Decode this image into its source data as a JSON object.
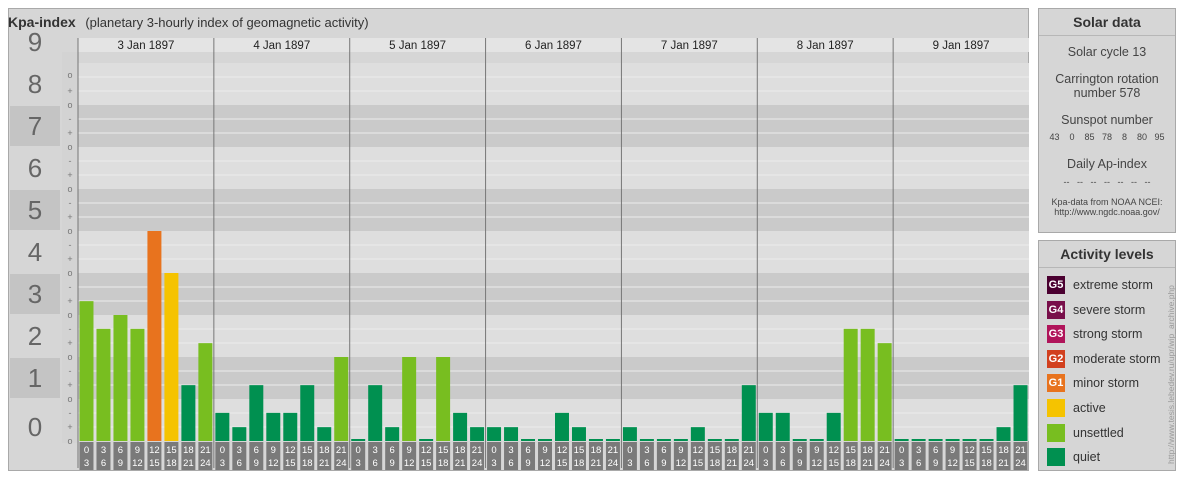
{
  "header": {
    "title": "Kpa-index",
    "subtitle": "(planetary 3-hourly index of geomagnetic activity)"
  },
  "chart_data": {
    "type": "bar",
    "title": "Kpa-index",
    "subtitle": "(planetary 3-hourly index of geomagnetic activity)",
    "ylim": [
      0,
      9
    ],
    "y_ticks": [
      "0",
      "1",
      "2",
      "3",
      "4",
      "5",
      "6",
      "7",
      "8",
      "9"
    ],
    "y_minor_marks": [
      "-",
      "o",
      "+"
    ],
    "days": [
      "3 Jan 1897",
      "4 Jan 1897",
      "5 Jan 1897",
      "6 Jan 1897",
      "7 Jan 1897",
      "8 Jan 1897",
      "9 Jan 1897"
    ],
    "intervals": [
      [
        "0",
        "3"
      ],
      [
        "3",
        "6"
      ],
      [
        "6",
        "9"
      ],
      [
        "9",
        "12"
      ],
      [
        "12",
        "15"
      ],
      [
        "15",
        "18"
      ],
      [
        "18",
        "21"
      ],
      [
        "21",
        "24"
      ]
    ],
    "values": [
      [
        3.33,
        2.67,
        3.0,
        2.67,
        5.0,
        4.0,
        1.33,
        2.33
      ],
      [
        0.67,
        0.33,
        1.33,
        0.67,
        0.67,
        1.33,
        0.33,
        2.0
      ],
      [
        0.0,
        1.33,
        0.33,
        2.0,
        0.0,
        2.0,
        0.67,
        0.33
      ],
      [
        0.33,
        0.33,
        0.0,
        0.0,
        0.67,
        0.33,
        0.0,
        0.0
      ],
      [
        0.33,
        0.0,
        0.0,
        0.0,
        0.33,
        0.0,
        0.0,
        1.33
      ],
      [
        0.67,
        0.67,
        0.0,
        0.0,
        0.67,
        2.67,
        2.67,
        2.33
      ],
      [
        0.0,
        0.0,
        0.0,
        0.0,
        0.0,
        0.0,
        0.33,
        1.33
      ]
    ],
    "levels": [
      {
        "label": "extreme storm",
        "code": "G5",
        "color": "#4a0030"
      },
      {
        "label": "severe storm",
        "code": "G4",
        "color": "#780f4a"
      },
      {
        "label": "strong storm",
        "code": "G3",
        "color": "#b0145a"
      },
      {
        "label": "moderate storm",
        "code": "G2",
        "color": "#d2401e"
      },
      {
        "label": "minor storm",
        "code": "G1",
        "color": "#e8731e"
      },
      {
        "label": "active",
        "code": "",
        "color": "#f5c300"
      },
      {
        "label": "unsettled",
        "code": "",
        "color": "#78be20"
      },
      {
        "label": "quiet",
        "code": "",
        "color": "#009050"
      }
    ]
  },
  "solar": {
    "title": "Solar data",
    "cycle": "Solar cycle 13",
    "carrington_1": "Carrington rotation",
    "carrington_2": "number 578",
    "sunspot_label": "Sunspot number",
    "sunspots": "43    0    85   78    8    80   95",
    "ap_label": "Daily Ap-index",
    "ap_values": "--   --   --   --   --   --   --",
    "source_1": "Kpa-data from NOAA NCEI:",
    "source_2": "http://www.ngdc.noaa.gov/"
  },
  "activity": {
    "title": "Activity levels"
  },
  "credit": "http://www.tesis.lebedev.ru/upr/wip_archive.php"
}
